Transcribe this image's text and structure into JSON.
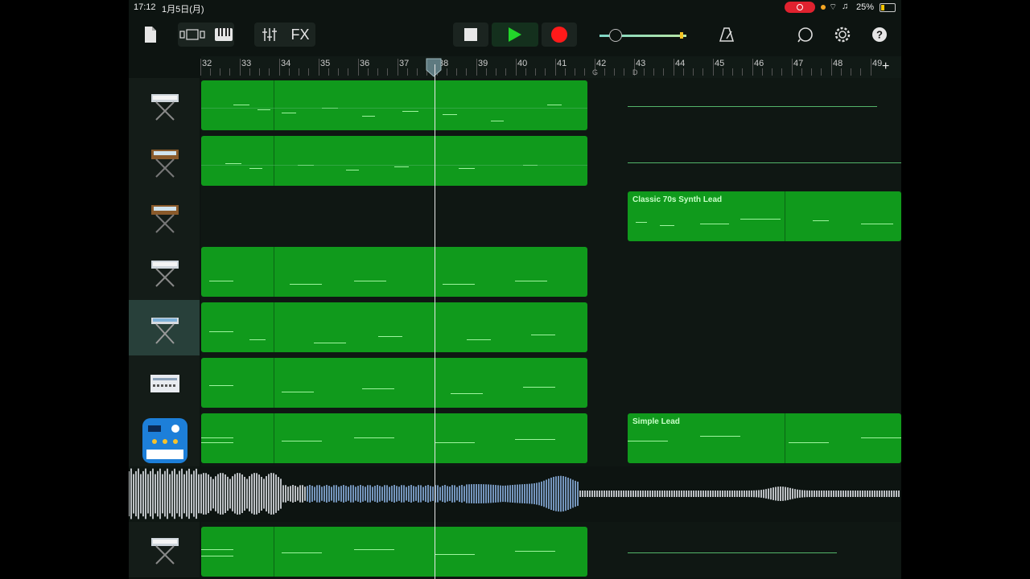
{
  "status": {
    "time": "17:12",
    "date": "1月5日(月)",
    "battery": "25%"
  },
  "toolbar": {
    "fx_label": "FX",
    "volume_level": 0.15
  },
  "ruler": {
    "bars": [
      "32",
      "33",
      "34",
      "35",
      "36",
      "37",
      "38",
      "39",
      "40",
      "41",
      "42",
      "43",
      "44",
      "45",
      "46",
      "47",
      "48",
      "49"
    ],
    "markers": [
      "G",
      "D"
    ]
  },
  "tracks": [
    {
      "name": "keyboard-track-1",
      "instrument_icon": "keyboard-silver-icon"
    },
    {
      "name": "synth-track-2",
      "instrument_icon": "synth-wood-icon"
    },
    {
      "name": "synth-track-3",
      "instrument_icon": "synth-wood-icon",
      "region_label": "Classic 70s Synth Lead"
    },
    {
      "name": "keyboard-track-4",
      "instrument_icon": "keyboard-silver-icon"
    },
    {
      "name": "keyboard-track-5",
      "instrument_icon": "keyboard-stand-icon",
      "selected": true
    },
    {
      "name": "drum-machine-track-6",
      "instrument_icon": "drum-machine-icon"
    },
    {
      "name": "synth-app-track-7",
      "instrument_icon": "synth-app-icon",
      "region_label": "Simple Lead"
    },
    {
      "name": "audio-waveform-track-8",
      "instrument_icon": "waveform-icon"
    },
    {
      "name": "keyboard-track-9",
      "instrument_icon": "keyboard-silver-icon"
    }
  ],
  "colors": {
    "region": "#109a1c",
    "play": "#22d52a",
    "record": "#ff1a1a",
    "background": "#0d1411"
  }
}
